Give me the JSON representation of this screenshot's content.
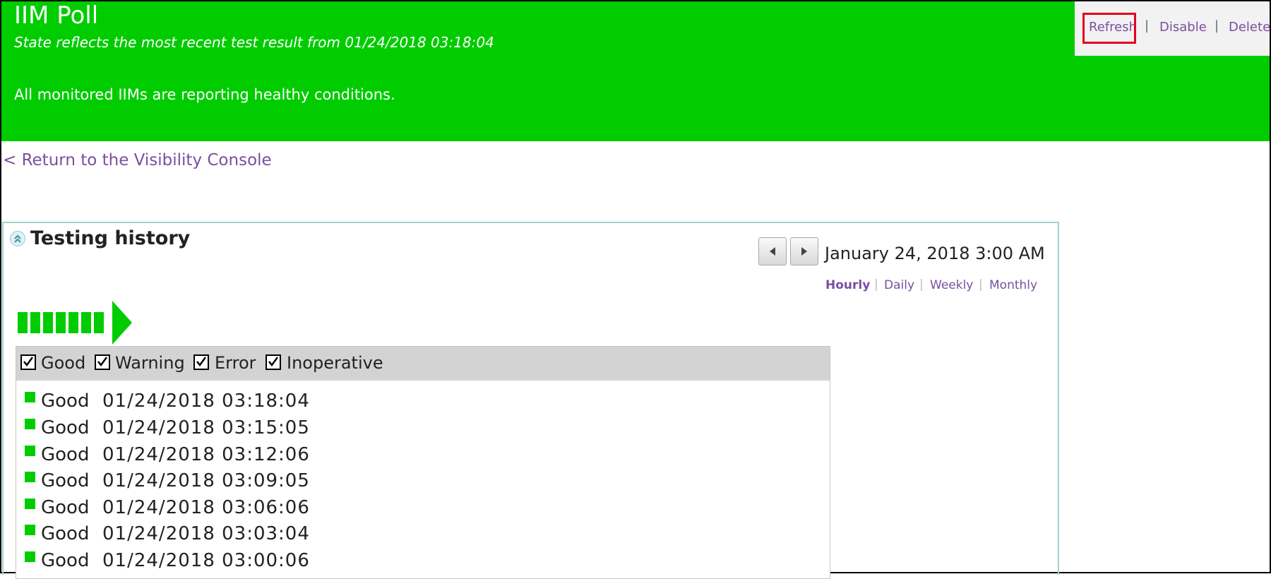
{
  "header": {
    "title": "IIM Poll",
    "subtitle": "State reflects the most recent test result from 01/24/2018 03:18:04",
    "status_message": "All monitored IIMs are reporting healthy conditions.",
    "background_color": "#00cc00"
  },
  "actions": {
    "refresh": "Refresh",
    "disable": "Disable",
    "delete": "Delete",
    "separator": "|",
    "highlight_color": "#e3001b"
  },
  "return_link": "< Return to the Visibility Console",
  "history": {
    "title": "Testing history",
    "collapse_icon": "double-chevron-up-icon",
    "current_date": "January 24, 2018 3:00 AM",
    "periods": [
      "Hourly",
      "Daily",
      "Weekly",
      "Monthly"
    ],
    "active_period": "Hourly",
    "status_strip_color": "#00cc00",
    "filters": [
      {
        "label": "Good",
        "checked": true
      },
      {
        "label": "Warning",
        "checked": true
      },
      {
        "label": "Error",
        "checked": true
      },
      {
        "label": "Inoperative",
        "checked": true
      }
    ],
    "results": [
      {
        "state": "Good",
        "time": "01/24/2018 03:18:04"
      },
      {
        "state": "Good",
        "time": "01/24/2018 03:15:05"
      },
      {
        "state": "Good",
        "time": "01/24/2018 03:12:06"
      },
      {
        "state": "Good",
        "time": "01/24/2018 03:09:05"
      },
      {
        "state": "Good",
        "time": "01/24/2018 03:06:06"
      },
      {
        "state": "Good",
        "time": "01/24/2018 03:03:04"
      },
      {
        "state": "Good",
        "time": "01/24/2018 03:00:06"
      }
    ]
  }
}
